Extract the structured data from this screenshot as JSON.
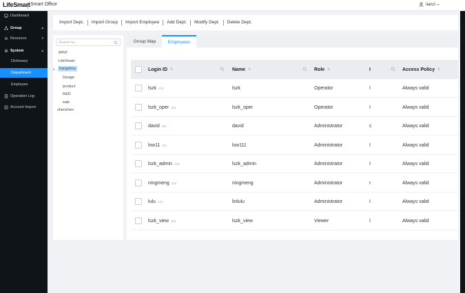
{
  "app": {
    "brand": "LifeSmart",
    "subtitle": "Smart Office",
    "user": "lianzi"
  },
  "sidebar": {
    "items": [
      {
        "label": "Dashboard",
        "icon": "monitor-icon"
      },
      {
        "label": "Group",
        "icon": "group-icon",
        "arrow": "▴"
      },
      {
        "label": "Resource",
        "icon": "gear-icon",
        "arrow": "▾"
      },
      {
        "label": "System",
        "icon": "settings-icon",
        "arrow": "▴"
      },
      {
        "label": "Dictionary"
      },
      {
        "label": "Department"
      },
      {
        "label": "Employee"
      },
      {
        "label": "Operation Log",
        "icon": "log-icon"
      },
      {
        "label": "Account Import",
        "icon": "import-icon"
      }
    ]
  },
  "toolbar": {
    "buttons": [
      "Import Dept.",
      "Import Group",
      "Import Employee",
      "Add Dept.",
      "Modify Dept.",
      "Delete Dept."
    ]
  },
  "tree": {
    "search_placeholder": "Search tre...",
    "nodes": [
      "ilPNT",
      "LifeSmart",
      "hangzhou",
      "Design",
      "product",
      "R&D",
      "sale",
      "shenzhen"
    ]
  },
  "tabs": [
    "Group Map",
    "Employees"
  ],
  "table": {
    "headers": [
      "Login ID",
      "Name",
      "Role",
      "I",
      "Access Policy"
    ],
    "rows": [
      {
        "login": "lszk",
        "id": "101",
        "name": "lszk",
        "role": "Operator",
        "i": "I",
        "policy": "Always valid"
      },
      {
        "login": "lszk_oper",
        "id": "104",
        "name": "lszk_oper",
        "role": "Operator",
        "i": "I",
        "policy": "Always valid"
      },
      {
        "login": "david",
        "id": "110",
        "name": "david",
        "role": "Administrator",
        "i": "c",
        "policy": "Always valid"
      },
      {
        "login": "lsw11",
        "id": "111",
        "name": "lsw111",
        "role": "Administrator",
        "i": "I",
        "policy": "Always valid"
      },
      {
        "login": "lszk_admin",
        "id": "109",
        "name": "lszk_admin",
        "role": "Administrator",
        "i": "I",
        "policy": "Always valid"
      },
      {
        "login": "ningmeng",
        "id": "102",
        "name": "ningmeng",
        "role": "Administrator",
        "i": "r",
        "policy": "Always valid"
      },
      {
        "login": "lulu",
        "id": "124",
        "name": "linlulu",
        "role": "Administrator",
        "i": "I",
        "policy": "Always valid"
      },
      {
        "login": "lszk_view",
        "id": "103",
        "name": "lszk_view",
        "role": "Viewer",
        "i": "I",
        "policy": "Always valid"
      }
    ]
  }
}
